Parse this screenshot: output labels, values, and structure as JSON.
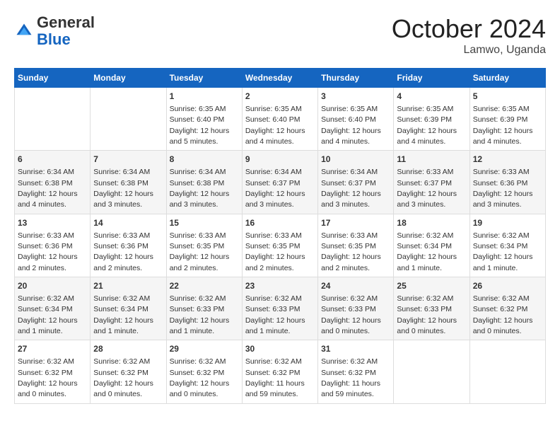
{
  "header": {
    "logo_line1": "General",
    "logo_line2": "Blue",
    "month": "October 2024",
    "location": "Lamwo, Uganda"
  },
  "weekdays": [
    "Sunday",
    "Monday",
    "Tuesday",
    "Wednesday",
    "Thursday",
    "Friday",
    "Saturday"
  ],
  "weeks": [
    [
      null,
      null,
      {
        "day": 1,
        "sunrise": "6:35 AM",
        "sunset": "6:40 PM",
        "daylight": "12 hours and 5 minutes."
      },
      {
        "day": 2,
        "sunrise": "6:35 AM",
        "sunset": "6:40 PM",
        "daylight": "12 hours and 4 minutes."
      },
      {
        "day": 3,
        "sunrise": "6:35 AM",
        "sunset": "6:40 PM",
        "daylight": "12 hours and 4 minutes."
      },
      {
        "day": 4,
        "sunrise": "6:35 AM",
        "sunset": "6:39 PM",
        "daylight": "12 hours and 4 minutes."
      },
      {
        "day": 5,
        "sunrise": "6:35 AM",
        "sunset": "6:39 PM",
        "daylight": "12 hours and 4 minutes."
      }
    ],
    [
      {
        "day": 6,
        "sunrise": "6:34 AM",
        "sunset": "6:38 PM",
        "daylight": "12 hours and 4 minutes."
      },
      {
        "day": 7,
        "sunrise": "6:34 AM",
        "sunset": "6:38 PM",
        "daylight": "12 hours and 3 minutes."
      },
      {
        "day": 8,
        "sunrise": "6:34 AM",
        "sunset": "6:38 PM",
        "daylight": "12 hours and 3 minutes."
      },
      {
        "day": 9,
        "sunrise": "6:34 AM",
        "sunset": "6:37 PM",
        "daylight": "12 hours and 3 minutes."
      },
      {
        "day": 10,
        "sunrise": "6:34 AM",
        "sunset": "6:37 PM",
        "daylight": "12 hours and 3 minutes."
      },
      {
        "day": 11,
        "sunrise": "6:33 AM",
        "sunset": "6:37 PM",
        "daylight": "12 hours and 3 minutes."
      },
      {
        "day": 12,
        "sunrise": "6:33 AM",
        "sunset": "6:36 PM",
        "daylight": "12 hours and 3 minutes."
      }
    ],
    [
      {
        "day": 13,
        "sunrise": "6:33 AM",
        "sunset": "6:36 PM",
        "daylight": "12 hours and 2 minutes."
      },
      {
        "day": 14,
        "sunrise": "6:33 AM",
        "sunset": "6:36 PM",
        "daylight": "12 hours and 2 minutes."
      },
      {
        "day": 15,
        "sunrise": "6:33 AM",
        "sunset": "6:35 PM",
        "daylight": "12 hours and 2 minutes."
      },
      {
        "day": 16,
        "sunrise": "6:33 AM",
        "sunset": "6:35 PM",
        "daylight": "12 hours and 2 minutes."
      },
      {
        "day": 17,
        "sunrise": "6:33 AM",
        "sunset": "6:35 PM",
        "daylight": "12 hours and 2 minutes."
      },
      {
        "day": 18,
        "sunrise": "6:32 AM",
        "sunset": "6:34 PM",
        "daylight": "12 hours and 1 minute."
      },
      {
        "day": 19,
        "sunrise": "6:32 AM",
        "sunset": "6:34 PM",
        "daylight": "12 hours and 1 minute."
      }
    ],
    [
      {
        "day": 20,
        "sunrise": "6:32 AM",
        "sunset": "6:34 PM",
        "daylight": "12 hours and 1 minute."
      },
      {
        "day": 21,
        "sunrise": "6:32 AM",
        "sunset": "6:34 PM",
        "daylight": "12 hours and 1 minute."
      },
      {
        "day": 22,
        "sunrise": "6:32 AM",
        "sunset": "6:33 PM",
        "daylight": "12 hours and 1 minute."
      },
      {
        "day": 23,
        "sunrise": "6:32 AM",
        "sunset": "6:33 PM",
        "daylight": "12 hours and 1 minute."
      },
      {
        "day": 24,
        "sunrise": "6:32 AM",
        "sunset": "6:33 PM",
        "daylight": "12 hours and 0 minutes."
      },
      {
        "day": 25,
        "sunrise": "6:32 AM",
        "sunset": "6:33 PM",
        "daylight": "12 hours and 0 minutes."
      },
      {
        "day": 26,
        "sunrise": "6:32 AM",
        "sunset": "6:32 PM",
        "daylight": "12 hours and 0 minutes."
      }
    ],
    [
      {
        "day": 27,
        "sunrise": "6:32 AM",
        "sunset": "6:32 PM",
        "daylight": "12 hours and 0 minutes."
      },
      {
        "day": 28,
        "sunrise": "6:32 AM",
        "sunset": "6:32 PM",
        "daylight": "12 hours and 0 minutes."
      },
      {
        "day": 29,
        "sunrise": "6:32 AM",
        "sunset": "6:32 PM",
        "daylight": "12 hours and 0 minutes."
      },
      {
        "day": 30,
        "sunrise": "6:32 AM",
        "sunset": "6:32 PM",
        "daylight": "11 hours and 59 minutes."
      },
      {
        "day": 31,
        "sunrise": "6:32 AM",
        "sunset": "6:32 PM",
        "daylight": "11 hours and 59 minutes."
      },
      null,
      null
    ]
  ]
}
